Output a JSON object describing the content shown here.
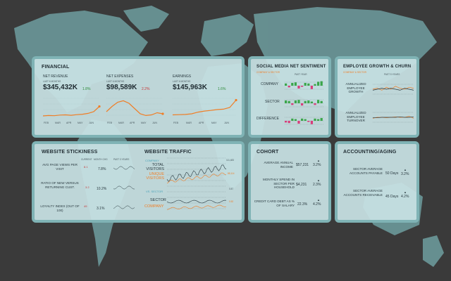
{
  "colors": {
    "accent": "#f07e26",
    "teal": "#4aa3b8",
    "green": "#3aa64a",
    "red": "#d83c7a",
    "frame": "#7fb3b5"
  },
  "financial": {
    "title": "FINANCIAL",
    "months": [
      "FEB",
      "MAR",
      "APR",
      "MAY",
      "JUN"
    ],
    "revenue": {
      "label": "NET REVENUE",
      "sub": "LAST 6 MONTHS",
      "value": "$345,432K",
      "delta": "1.8%",
      "trend": [
        0.1,
        0.12,
        0.11,
        0.14,
        0.15,
        0.13,
        0.16,
        0.18,
        0.22,
        0.3,
        0.55
      ]
    },
    "expenses": {
      "label": "NET EXPENSES",
      "sub": "LAST 6 MONTHS",
      "value": "$98,589K",
      "delta": "2.2%",
      "trend": [
        0.3,
        0.55,
        0.75,
        0.82,
        0.7,
        0.45,
        0.2,
        0.12,
        0.15,
        0.25,
        0.2
      ]
    },
    "earnings": {
      "label": "EARNINGS",
      "sub": "LAST 6 MONTHS",
      "value": "$145,963K",
      "delta": "1.6%",
      "trend": [
        0.15,
        0.16,
        0.17,
        0.2,
        0.28,
        0.33,
        0.36,
        0.4,
        0.42,
        0.5,
        0.85
      ]
    }
  },
  "social": {
    "title": "SOCIAL MEDIA NET SENTIMENT",
    "legend": "COMPANY & SECTOR",
    "period": "PAST YEAR",
    "rows": [
      {
        "label": "COMPANY",
        "bars": [
          0.4,
          -0.3,
          0.5,
          0.6,
          -0.5,
          -0.2,
          0.5,
          0.4,
          -0.6,
          0.3,
          0.7,
          0.8
        ]
      },
      {
        "label": "SECTOR",
        "bars": [
          0.5,
          0.4,
          -0.3,
          0.5,
          0.6,
          -0.4,
          0.4,
          0.5,
          0.3,
          -0.3,
          0.6,
          0.4
        ]
      },
      {
        "label": "DIFFERENCE",
        "bars": [
          -0.3,
          -0.4,
          0.4,
          0.3,
          -0.5,
          0.4,
          0.3,
          -0.2,
          -0.6,
          0.4,
          0.3,
          0.5
        ]
      }
    ]
  },
  "employee": {
    "title": "EMPLOYEE GROWTH & CHURN",
    "legend": "COMPANY & SECTOR",
    "period": "PAST 5 YEARS",
    "rows": [
      {
        "label": "ANNUALIZED EMPLOYEE GROWTH"
      },
      {
        "label": "ANNUALIZED EMPLOYEE TURNOVER"
      }
    ]
  },
  "stickiness": {
    "title": "WEBSITE STICKINESS",
    "headers": [
      "CURRENT",
      "MONTH CHG",
      "PAST 3 YEARS"
    ],
    "rows": [
      {
        "label": "AVG PAGE VIEWS PER VISIT",
        "current": "8.1",
        "change": "7.8%"
      },
      {
        "label": "RATIO OF NEW VERSUS RETURNING CUST.",
        "current": "3.2",
        "change": "10.2%"
      },
      {
        "label": "LOYALTY INDEX (OUT OF 100)",
        "current": "49",
        "change": "3.1%"
      }
    ]
  },
  "traffic": {
    "title": "WEBSITE TRAFFIC",
    "series_a": {
      "company": "COMPANY",
      "total": "TOTAL VISITORS",
      "unique": "UNIQUE VISITORS"
    },
    "series_b": {
      "sector": "VS. SECTOR",
      "sector_label": "SECTOR",
      "company": "COMPANY"
    },
    "end_values": [
      "111,483",
      "85,114",
      "0.87",
      "0.52"
    ]
  },
  "cohort": {
    "title": "COHORT",
    "rows": [
      {
        "label": "AVERAGE ANNUAL INCOME",
        "value": "$57,231",
        "change": "3.2%"
      },
      {
        "label": "MONTHLY SPEND IN SECTOR PER HOUSEHOLD",
        "value": "$4,231",
        "change": "2.3%"
      },
      {
        "label": "CREDIT CARD DEBT AS % OF SALARY",
        "value": "22.3%",
        "change": "4.2%"
      }
    ]
  },
  "accounting": {
    "title": "ACCOUNTING/AGING",
    "rows": [
      {
        "label": "SECTOR AVERAGE ACCOUNTS PAYABLE",
        "value": "50 Days",
        "change": "3.2%"
      },
      {
        "label": "SECTOR AVERAGE ACCOUNTS RECEIVABLE",
        "value": "45 Days",
        "change": "4.2%"
      }
    ]
  }
}
